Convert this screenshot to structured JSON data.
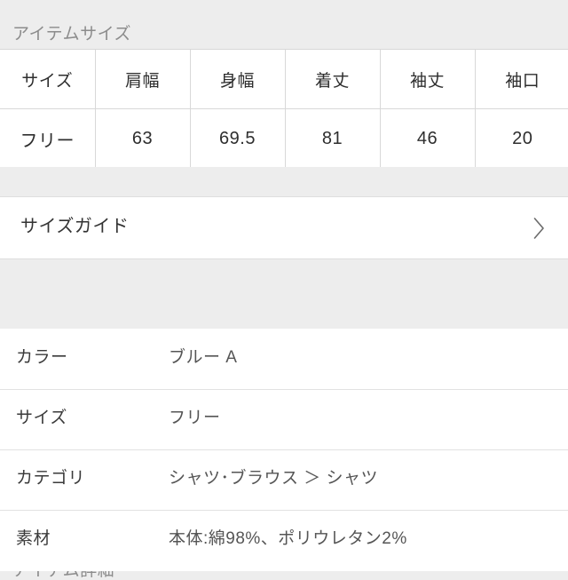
{
  "size_section": {
    "title": "アイテムサイズ",
    "table": {
      "headers": [
        "サイズ",
        "肩幅",
        "身幅",
        "着丈",
        "袖丈",
        "袖口"
      ],
      "rows": [
        [
          "フリー",
          "63",
          "69.5",
          "81",
          "46",
          "20"
        ]
      ]
    }
  },
  "size_guide": {
    "label": "サイズガイド",
    "chevron_icon": "chevron-right-icon"
  },
  "detail_section": {
    "title": "アイテム詳細",
    "rows": [
      {
        "label": "カラー",
        "value": "ブルー A"
      },
      {
        "label": "サイズ",
        "value": "フリー"
      },
      {
        "label": "カテゴリ",
        "value": "シャツ･ブラウス ＞ シャツ"
      },
      {
        "label": "素材",
        "value": "本体:綿98%、ポリウレタン2%"
      }
    ]
  },
  "colors": {
    "page_background": "#ededed",
    "card_background": "#ffffff",
    "divider": "#d8d8d8",
    "section_title_text": "#8c8c8c",
    "primary_text": "#2e2e2e",
    "value_text": "#555555"
  }
}
